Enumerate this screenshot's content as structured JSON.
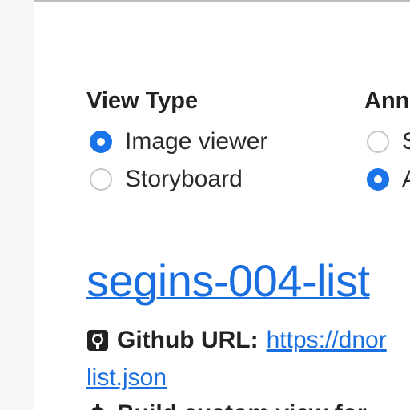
{
  "view_type": {
    "title": "View Type",
    "options": [
      {
        "label": "Image viewer",
        "checked": true
      },
      {
        "label": "Storyboard",
        "checked": false
      }
    ]
  },
  "annotations": {
    "title": "Ann",
    "options": [
      {
        "label": "S",
        "checked": false
      },
      {
        "label": "A",
        "checked": true
      }
    ]
  },
  "dataset": {
    "title": "segins-004-list",
    "github_label": "Github URL:",
    "github_url_line1": "https://dnor",
    "github_url_line2": "list.json",
    "next_text": "Build custom view for"
  },
  "colors": {
    "accent": "#1a73e8",
    "link": "#1a6fe0"
  },
  "icons": {
    "github": "github-icon",
    "gear": "gear-icon"
  }
}
